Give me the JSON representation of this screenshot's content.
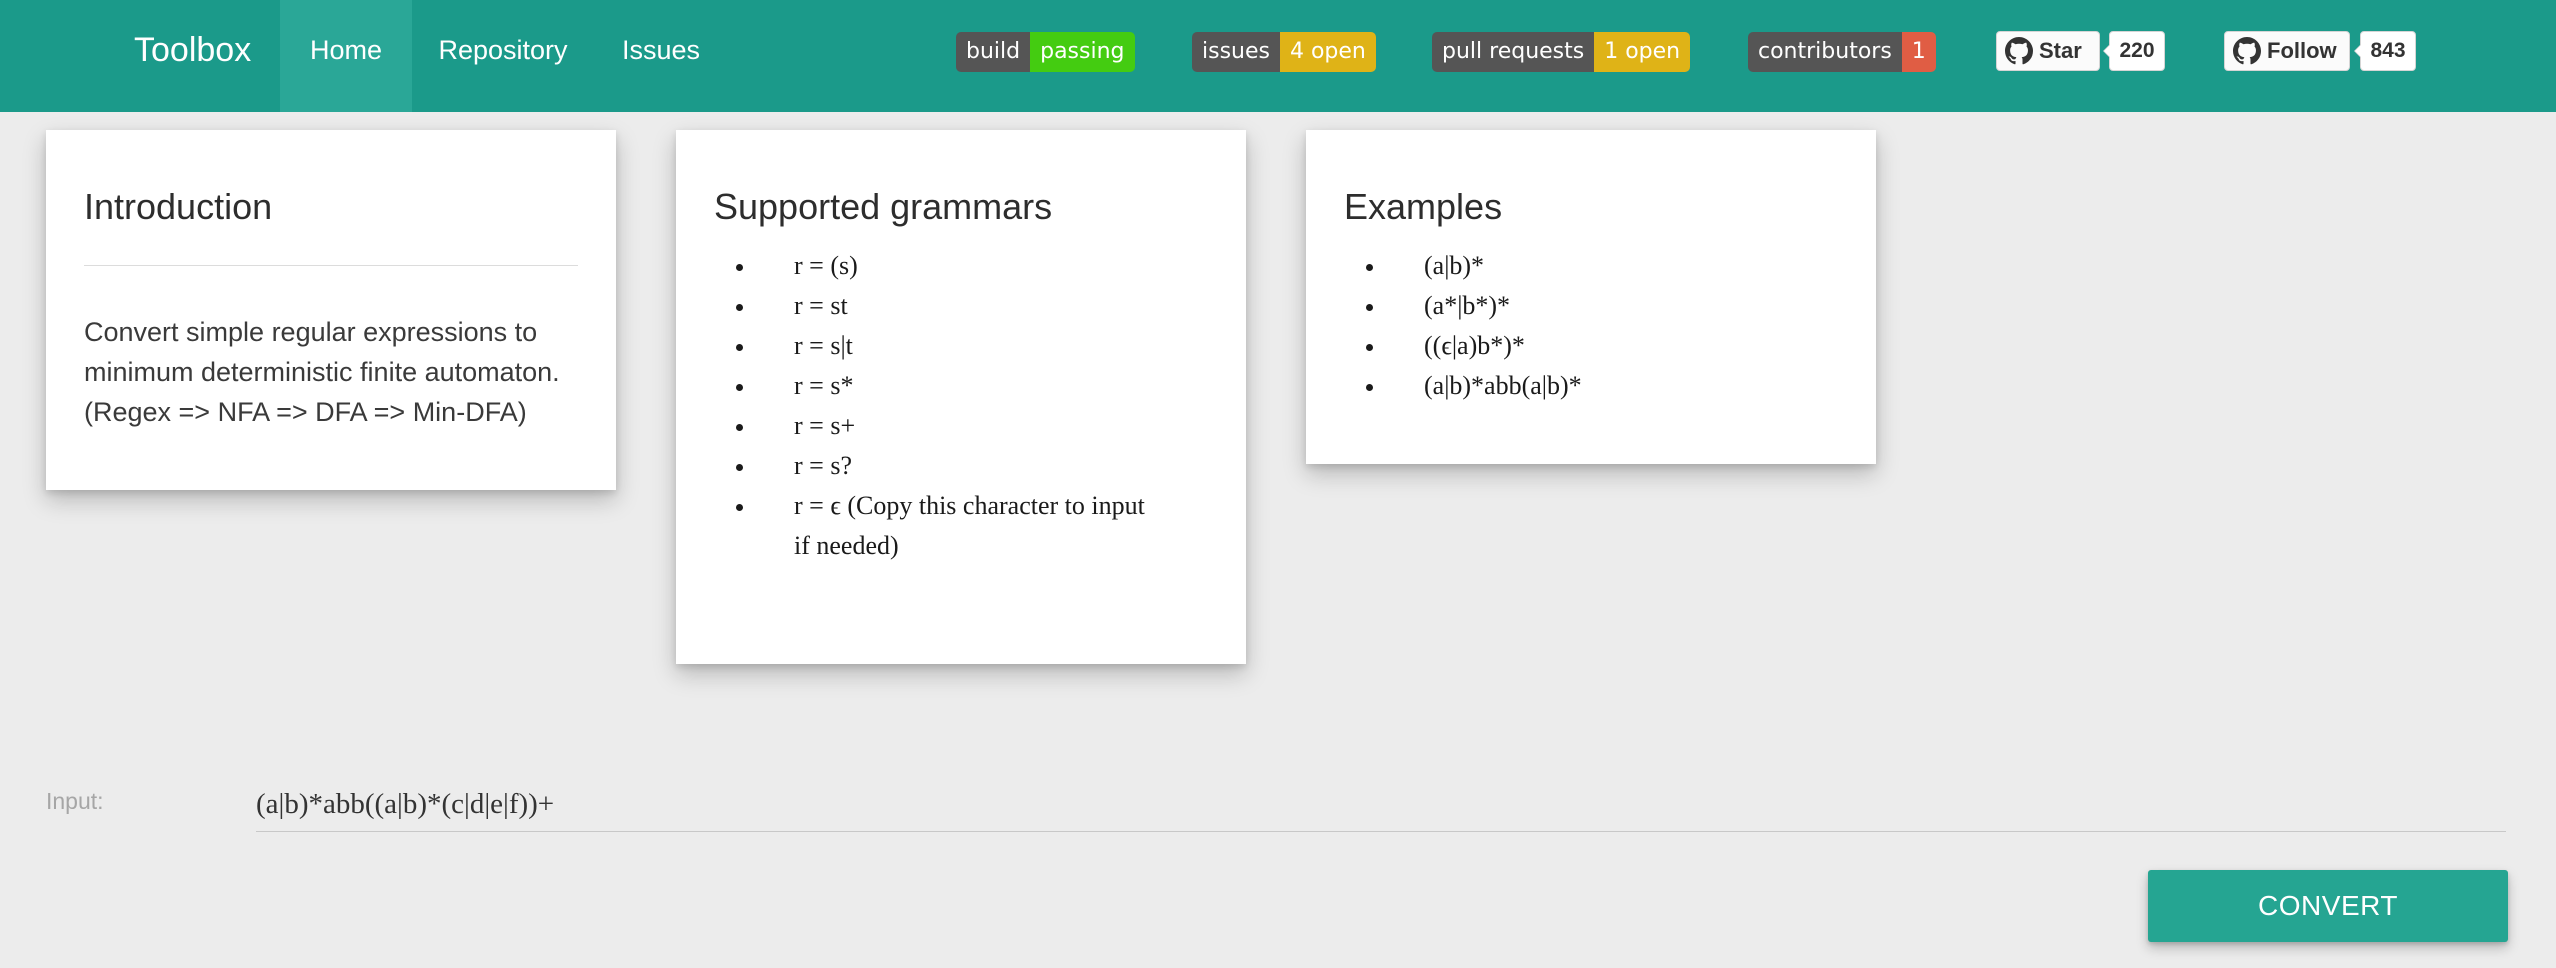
{
  "nav": {
    "brand": "Toolbox",
    "items": [
      {
        "label": "Home",
        "active": true
      },
      {
        "label": "Repository",
        "active": false
      },
      {
        "label": "Issues",
        "active": false
      }
    ]
  },
  "badges": [
    {
      "label": "build",
      "value": "passing",
      "color": "#44cc11"
    },
    {
      "label": "issues",
      "value": "4 open",
      "color": "#dfb317"
    },
    {
      "label": "pull requests",
      "value": "1 open",
      "color": "#dfb317"
    },
    {
      "label": "contributors",
      "value": "1",
      "color": "#e05d44"
    }
  ],
  "github": {
    "star": {
      "label": "Star",
      "count": "220",
      "icon": "github-icon"
    },
    "follow": {
      "label": "Follow",
      "count": "843",
      "icon": "github-icon"
    }
  },
  "cards": {
    "introduction": {
      "title": "Introduction",
      "text": "Convert simple regular expressions to minimum deterministic finite automaton. (Regex => NFA => DFA => Min-DFA)"
    },
    "grammars": {
      "title": "Supported grammars",
      "items": [
        "r = (s)",
        "r = st",
        "r = s|t",
        "r = s*",
        "r = s+",
        "r = s?",
        "r = ϵ (Copy this character to input if needed)"
      ]
    },
    "examples": {
      "title": "Examples",
      "items": [
        "(a|b)*",
        "(a*|b*)*",
        "((ϵ|a)b*)*",
        "(a|b)*abb(a|b)*"
      ]
    }
  },
  "input": {
    "label": "Input:",
    "value": "(a|b)*abb((a|b)*(c|d|e|f))+"
  },
  "convert_button": {
    "label": "CONVERT"
  },
  "colors": {
    "navbar": "#1b9a8a",
    "nav_active": "#2aa797",
    "button": "#25a592",
    "background": "#ececec"
  }
}
